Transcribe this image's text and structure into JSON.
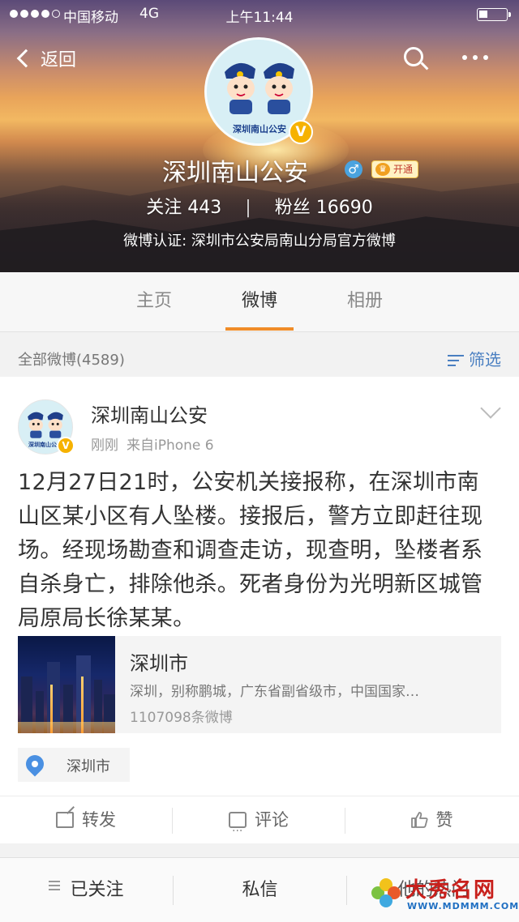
{
  "status_bar": {
    "carrier": "中国移动",
    "network": "4G",
    "time": "上午11:44",
    "signal_bars_filled": 4,
    "signal_bars_total": 5
  },
  "nav": {
    "back_label": "返回"
  },
  "profile": {
    "avatar_caption": "深圳南山公安",
    "verified_badge": "V",
    "name": "深圳南山公安",
    "gender_symbol": "♂",
    "vip_label": "开通",
    "following_label": "关注",
    "following_count": "443",
    "followers_label": "粉丝",
    "followers_count": "16690",
    "verification": "微博认证: 深圳市公安局南山分局官方微博"
  },
  "tabs": [
    {
      "label": "主页",
      "active": false
    },
    {
      "label": "微博",
      "active": true
    },
    {
      "label": "相册",
      "active": false
    }
  ],
  "feed_header": {
    "count_label": "全部微博(4589)",
    "filter_label": "筛选"
  },
  "post": {
    "author": "深圳南山公安",
    "avatar_caption": "深圳南山公安",
    "time": "刚刚",
    "source": "来自iPhone 6",
    "text": "12月27日21时，公安机关接报称，在深圳市南山区某小区有人坠楼。接报后，警方立即赶往现场。经现场勘查和调查走访，现查明，坠楼者系自杀身亡，排除他杀。死者身份为光明新区城管局原局长徐某某。",
    "link_card": {
      "title": "深圳市",
      "description": "深圳，别称鹏城，广东省副省级市，中国国家…",
      "count": "1107098条微博"
    },
    "location": "深圳市",
    "actions": {
      "repost": "转发",
      "comment": "评论",
      "like": "赞"
    }
  },
  "bottom_bar": {
    "following": "已关注",
    "message": "私信",
    "third": "他的热门"
  },
  "watermark": {
    "title": "大秀名网",
    "url": "WWW.MDMMM.COM"
  },
  "colors": {
    "accent_orange": "#f08c28",
    "link_blue": "#4a7fc1",
    "verified_gold": "#f6b200"
  }
}
